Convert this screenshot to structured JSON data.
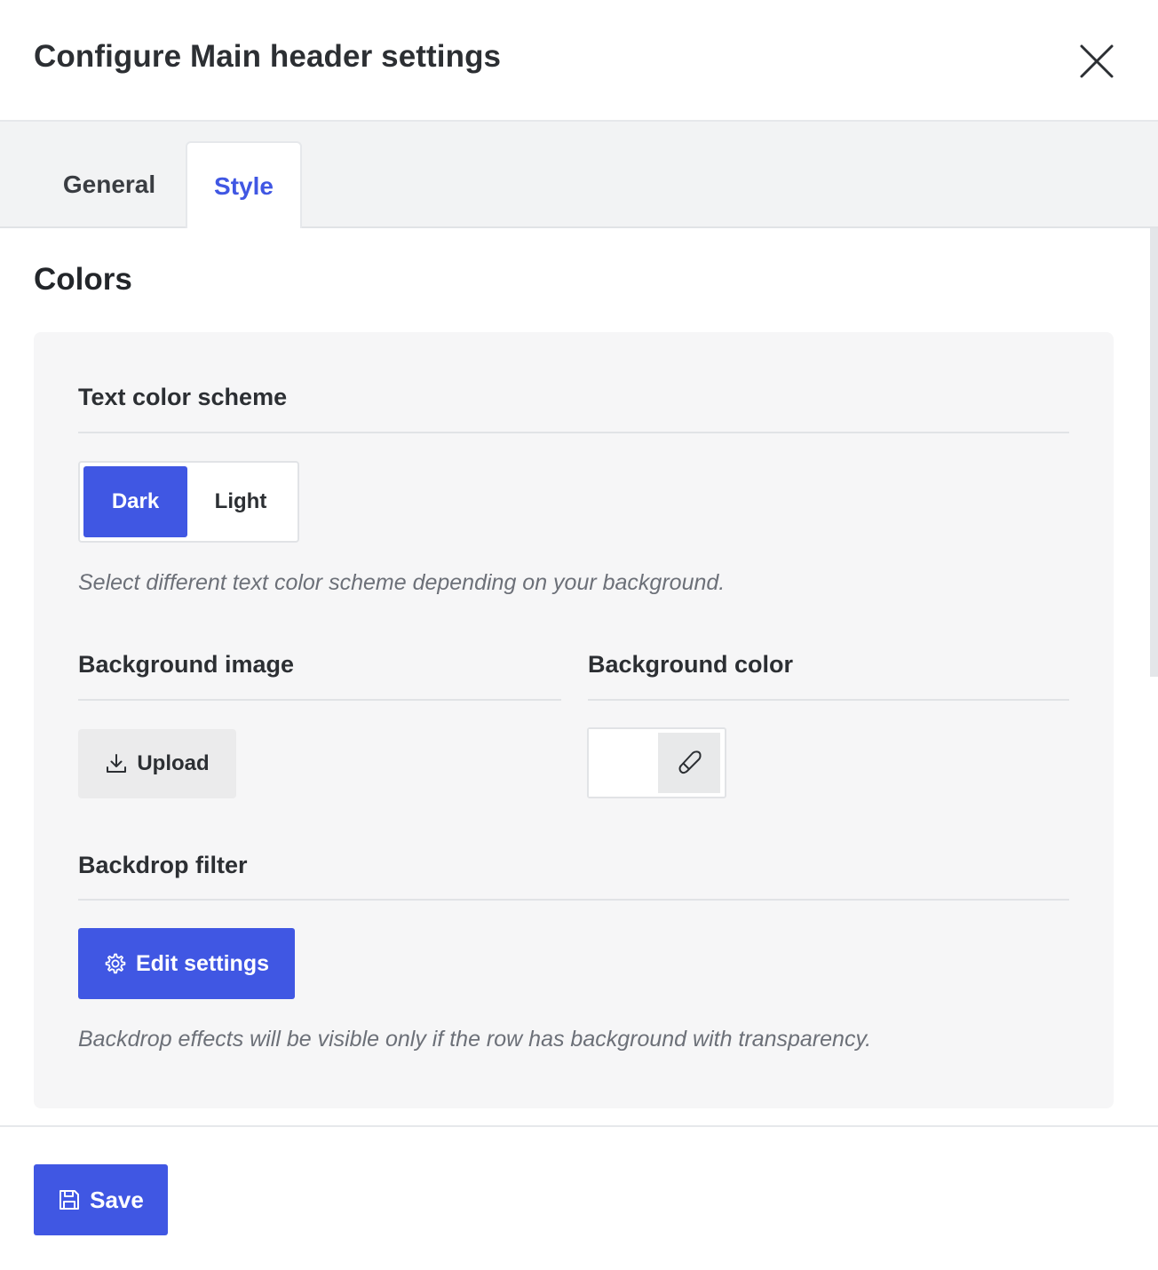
{
  "header": {
    "title": "Configure Main header settings",
    "close_icon": "close-icon"
  },
  "tabs": [
    {
      "label": "General",
      "active": false
    },
    {
      "label": "Style",
      "active": true
    }
  ],
  "colors_section": {
    "title": "Colors",
    "text_color_scheme": {
      "label": "Text color scheme",
      "options": [
        "Dark",
        "Light"
      ],
      "selected": "Dark",
      "help": "Select different text color scheme depending on your background."
    },
    "background_image": {
      "label": "Background image",
      "upload_label": "Upload",
      "icon": "download-icon"
    },
    "background_color": {
      "label": "Background color",
      "value": "#ffffff",
      "icon": "eyedropper-icon"
    },
    "backdrop_filter": {
      "label": "Backdrop filter",
      "button_label": "Edit settings",
      "icon": "gear-icon",
      "help": "Backdrop effects will be visible only if the row has background with transparency."
    }
  },
  "footer": {
    "save_label": "Save",
    "icon": "floppy-disk-icon"
  },
  "theme": {
    "accent": "#4057e3",
    "panel_bg": "#f6f6f7"
  }
}
